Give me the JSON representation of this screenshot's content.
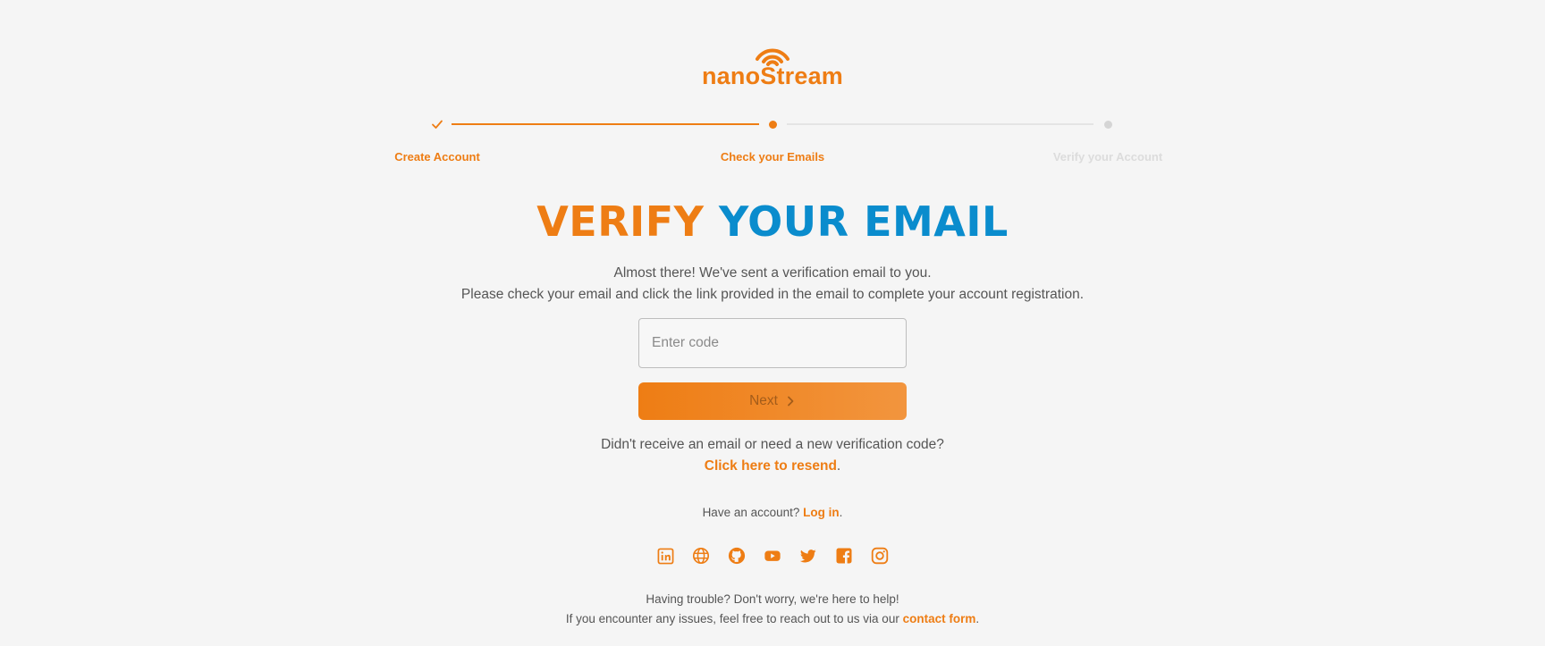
{
  "brand": {
    "name": "nanoStream",
    "accent_color": "#ee7d14",
    "secondary_color": "#0a8ccd"
  },
  "stepper": {
    "steps": [
      {
        "label": "Create Account",
        "state": "completed"
      },
      {
        "label": "Check your Emails",
        "state": "active"
      },
      {
        "label": "Verify your Account",
        "state": "pending"
      }
    ]
  },
  "heading": {
    "part1": "VERIFY",
    "part2": "YOUR EMAIL"
  },
  "description": {
    "line1": "Almost there! We've sent a verification email to you.",
    "line2": "Please check your email and click the link provided in the email to complete your account registration."
  },
  "form": {
    "code_placeholder": "Enter code",
    "code_value": "",
    "next_label": "Next"
  },
  "resend": {
    "question": "Didn't receive an email or need a new verification code?",
    "link_label": "Click here to resend",
    "suffix": "."
  },
  "login": {
    "prompt": "Have an account?",
    "link_label": "Log in",
    "suffix": "."
  },
  "socials": [
    {
      "icon": "linkedin-icon"
    },
    {
      "icon": "globe-icon"
    },
    {
      "icon": "github-icon"
    },
    {
      "icon": "youtube-icon"
    },
    {
      "icon": "twitter-icon"
    },
    {
      "icon": "facebook-icon"
    },
    {
      "icon": "instagram-icon"
    }
  ],
  "help": {
    "line1": "Having trouble? Don't worry, we're here to help!",
    "line2_prefix": "If you encounter any issues, feel free to reach out to us via our",
    "link_label": "contact form",
    "suffix": "."
  }
}
